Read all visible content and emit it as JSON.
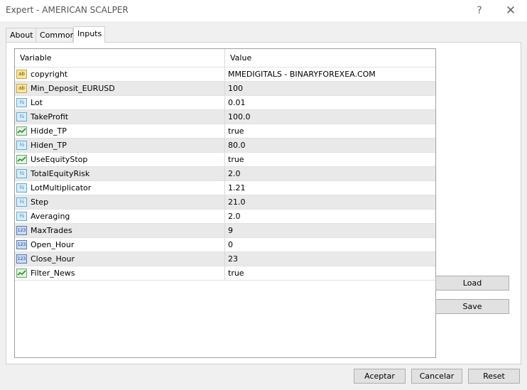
{
  "window": {
    "title": "Expert - AMERICAN SCALPER",
    "help_glyph": "?",
    "close_glyph": "✕"
  },
  "tabs": [
    {
      "label": "About",
      "active": false
    },
    {
      "label": "Common",
      "active": false
    },
    {
      "label": "Inputs",
      "active": true
    }
  ],
  "grid": {
    "headers": {
      "variable": "Variable",
      "value": "Value"
    },
    "rows": [
      {
        "icon": "string-icon",
        "name": "copyright",
        "value": "MMEDIGITALS - BINARYFOREXEA.COM"
      },
      {
        "icon": "string-icon",
        "name": "Min_Deposit_EURUSD",
        "value": "100"
      },
      {
        "icon": "double-icon",
        "name": "Lot",
        "value": "0.01"
      },
      {
        "icon": "double-icon",
        "name": "TakeProfit",
        "value": "100.0"
      },
      {
        "icon": "bool-icon",
        "name": "Hidde_TP",
        "value": "true"
      },
      {
        "icon": "double-icon",
        "name": "Hiden_TP",
        "value": "80.0"
      },
      {
        "icon": "bool-icon",
        "name": "UseEquityStop",
        "value": "true"
      },
      {
        "icon": "double-icon",
        "name": "TotalEquityRisk",
        "value": "2.0"
      },
      {
        "icon": "double-icon",
        "name": "LotMultiplicator",
        "value": "1.21"
      },
      {
        "icon": "double-icon",
        "name": "Step",
        "value": "21.0"
      },
      {
        "icon": "double-icon",
        "name": "Averaging",
        "value": "2.0"
      },
      {
        "icon": "int-icon",
        "name": "MaxTrades",
        "value": "9"
      },
      {
        "icon": "int-icon",
        "name": "Open_Hour",
        "value": "0"
      },
      {
        "icon": "int-icon",
        "name": "Close_Hour",
        "value": "23"
      },
      {
        "icon": "bool-icon",
        "name": "Filter_News",
        "value": "true"
      }
    ]
  },
  "side_buttons": {
    "load": "Load",
    "save": "Save"
  },
  "footer_buttons": {
    "ok": "Aceptar",
    "cancel": "Cancelar",
    "reset": "Reset"
  },
  "icon_glyphs": {
    "string-icon": "ab",
    "double-icon": "½",
    "int-icon": "123"
  }
}
